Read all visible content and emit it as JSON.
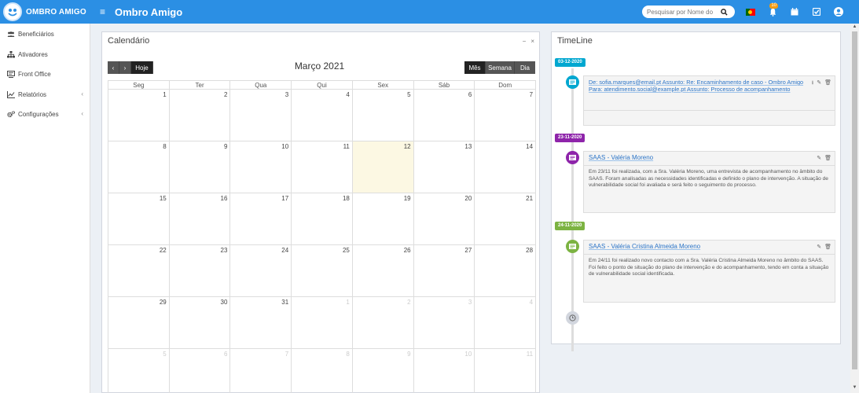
{
  "brand": {
    "name": "OMBRO AMIGO"
  },
  "app": {
    "title": "Ombro Amigo"
  },
  "header": {
    "search_placeholder": "Pesquisar por Nome do",
    "notification_count": "10"
  },
  "sidebar": {
    "items": [
      {
        "label": "Beneficiários",
        "icon": "users-icon"
      },
      {
        "label": "Ativadores",
        "icon": "sitemap-icon"
      },
      {
        "label": "Front Office",
        "icon": "desk-icon"
      },
      {
        "label": "Relatórios",
        "icon": "chart-icon"
      },
      {
        "label": "Configurações",
        "icon": "gears-icon"
      }
    ]
  },
  "calendar": {
    "panel_title": "Calendário",
    "month_title": "Março 2021",
    "today_button": "Hoje",
    "views": [
      "Mês",
      "Semana",
      "Dia"
    ],
    "weekdays": [
      "Seg",
      "Ter",
      "Qua",
      "Qui",
      "Sex",
      "Sáb",
      "Dom"
    ],
    "weeks": [
      [
        "1",
        "2",
        "3",
        "4",
        "5",
        "6",
        "7"
      ],
      [
        "8",
        "9",
        "10",
        "11",
        "12",
        "13",
        "14"
      ],
      [
        "15",
        "16",
        "17",
        "18",
        "19",
        "20",
        "21"
      ],
      [
        "22",
        "23",
        "24",
        "25",
        "26",
        "27",
        "28"
      ],
      [
        "29",
        "30",
        "31",
        "1",
        "2",
        "3",
        "4"
      ],
      [
        "5",
        "6",
        "7",
        "8",
        "9",
        "10",
        "11"
      ]
    ],
    "today": "12"
  },
  "timeline": {
    "panel_title": "TimeLine",
    "entries": [
      {
        "date": "03-12-2020",
        "color": "#00a7d0",
        "title": "De: sofia.marques@email.pt Assunto: Re: Encaminhamento de caso - Ombro Amigo",
        "title_line2": "Para: atendimento.social@example.pt Assunto: Processo de acompanhamento",
        "body": ""
      },
      {
        "date": "23-11-2020",
        "color": "#8e24aa",
        "title": "SAAS - Valéria Moreno",
        "body": "Em 23/11 foi realizada, com a Sra. Valéria Moreno, uma entrevista de acompanhamento no âmbito do SAAS. Foram analisadas as necessidades identificadas e definido o plano de intervenção. A situação de vulnerabilidade social foi avaliada e será feito o seguimento do processo."
      },
      {
        "date": "24-11-2020",
        "color": "#7cb342",
        "title": "SAAS - Valéria Cristina Almeida Moreno",
        "body": "Em 24/11 foi realizado novo contacto com a Sra. Valéria Cristina Almeida Moreno no âmbito do SAAS. Foi feito o ponto de situação do plano de intervenção e do acompanhamento, tendo em conta a situação de vulnerabilidade social identificada."
      }
    ]
  }
}
